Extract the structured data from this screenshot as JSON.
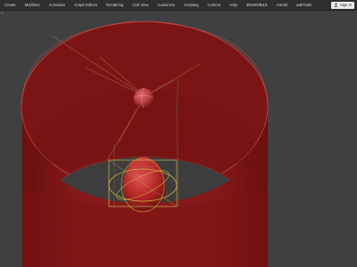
{
  "menubar": {
    "items": [
      "Create",
      "Modifiers",
      "Animation",
      "Graph Editors",
      "Rendering",
      "Civil View",
      "Customize",
      "Scripting",
      "Content",
      "Help",
      "3DSMOBILE",
      "Arnold",
      "wakTools"
    ],
    "signin_label": "Sign In"
  },
  "viewport": {
    "corner_label": "+",
    "colors": {
      "background": "#404040",
      "cylinder": "#7e1414",
      "rim": "#c23a3a",
      "light_wire": "#8a4a3a",
      "bright_wire": "#b99a36",
      "sphere": "#c85050"
    }
  }
}
